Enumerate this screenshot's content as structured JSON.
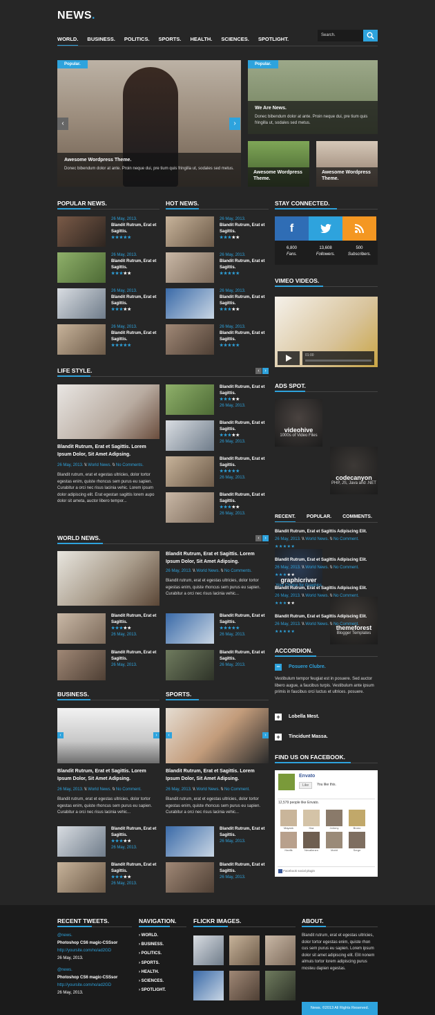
{
  "logo": {
    "text": "NEWS",
    "dot": "."
  },
  "nav": [
    "WORLD.",
    "BUSINESS.",
    "POLITICS.",
    "SPORTS.",
    "HEALTH.",
    "SCIENCES.",
    "SPOTLIGHT."
  ],
  "search": {
    "placeholder": "Search."
  },
  "slider": {
    "badge": "Popular.",
    "title": "Awesome Wordpress Theme.",
    "text": "Donec bibendum dolor at ante. Proin neque dui, pre tium quis fringilla ut,  sodales sed metus."
  },
  "popular_box": {
    "badge": "Popular.",
    "title": "We Are News.",
    "text": "Donec bibendum dolor at ante. Proin neque dui, pre tium quis fringilla ut,  sodales sed metus."
  },
  "small_tiles": [
    "Awesome Wordpress Theme.",
    "Awesome Wordpress Theme."
  ],
  "popular_news": {
    "title": "POPULAR NEWS.",
    "items": [
      {
        "date": "26 May, 2013.",
        "text": "Blandit Rutrum, Erat et Sagittis.",
        "stars": 5
      },
      {
        "date": "26 May, 2013.",
        "text": "Blandit Rutrum, Erat et Sagittis.",
        "stars": 3
      },
      {
        "date": "26 May, 2013.",
        "text": "Blandit Rutrum, Erat et Sagittis.",
        "stars": 3
      },
      {
        "date": "26 May, 2013.",
        "text": "Blandit Rutrum, Erat et Sagittis.",
        "stars": 5
      }
    ]
  },
  "hot_news": {
    "title": "HOT NEWS.",
    "items": [
      {
        "date": "26 May, 2013.",
        "text": "Blandit Rutrum, Erat et Sagittis.",
        "stars": 3
      },
      {
        "date": "26 May, 2013.",
        "text": "Blandit Rutrum, Erat et Sagittis.",
        "stars": 5
      },
      {
        "date": "26 May, 2013.",
        "text": "Blandit Rutrum, Erat et Sagittis.",
        "stars": 3
      },
      {
        "date": "26 May, 2013.",
        "text": "Blandit Rutrum, Erat et Sagittis.",
        "stars": 5
      }
    ]
  },
  "stay_connected": {
    "title": "STAY CONNECTED.",
    "stats": [
      {
        "num": "6,800",
        "label": "Fans."
      },
      {
        "num": "13,608",
        "label": "Followers."
      },
      {
        "num": "500",
        "label": "Subscribers."
      }
    ]
  },
  "vimeo": {
    "title": "VIMEO VIDEOS.",
    "time": "01:00"
  },
  "lifestyle": {
    "title": "LIFE STYLE.",
    "headline": "Blandit Rutrum, Erat et Sagittis. Lorem Ipsum Dolor, Sit Amet Adipsing.",
    "date": "26 May, 2013.",
    "sep": "\\\\",
    "cat": "World News.",
    "comments": "No Comments.",
    "body": "Blandit rutrum, erat et egestas ultricies, dolor tortor egestas enim, quiste rhoncus sem purus eu sapien. Curabitur a orci nec risus lacinia vehic. Lorem ipsum dolor adipiscing elit. Erat egestan sagittis lorem aupo dolor sit ameta, auctor libero tempor...",
    "items": [
      {
        "text": "Blandit Rutrum, Erat et Sagittis.",
        "date": "26 May, 2013.",
        "stars": 3
      },
      {
        "text": "Blandit Rutrum, Erat et Sagittis.",
        "date": "26 May, 2013.",
        "stars": 3
      },
      {
        "text": "Blandit Rutrum, Erat et Sagittis.",
        "date": "26 May, 2013.",
        "stars": 5
      },
      {
        "text": "Blandit Rutrum, Erat et Sagittis.",
        "date": "26 May, 2013.",
        "stars": 3
      }
    ]
  },
  "ads": {
    "title": "ADS SPOT.",
    "items": [
      {
        "name": "videohive",
        "sub": "1000s of Video Files"
      },
      {
        "name": "codecanyon",
        "sub": "PHP, JS, Java and .NET"
      },
      {
        "name": "graphicriver",
        "sub": "Your Choice for Graphics"
      },
      {
        "name": "themeforest",
        "sub": "Blogger Templates"
      }
    ]
  },
  "tabs": {
    "labels": [
      "RECENT.",
      "POPULAR.",
      "COMMENTS."
    ],
    "items": [
      {
        "text": "Blandit Rutrum, Erat et Sagittis Adipiscing Elit.",
        "date": "26 May, 2013.",
        "cat": "World News.",
        "comments": "No Comment.",
        "stars": 5
      },
      {
        "text": "Blandit Rutrum, Erat et Sagittis Adipiscing Elit.",
        "date": "26 May, 2013.",
        "cat": "World News.",
        "comments": "No Comment.",
        "stars": 3
      },
      {
        "text": "Blandit Rutrum, Erat et Sagittis Adipiscing Elit.",
        "date": "26 May, 2013.",
        "cat": "World News.",
        "comments": "No Comment.",
        "stars": 3
      },
      {
        "text": "Blandit Rutrum, Erat et Sagittis Adipiscing Elit.",
        "date": "26 May, 2013.",
        "cat": "World News.",
        "comments": "No Comment.",
        "stars": 5
      }
    ]
  },
  "world_news": {
    "title": "WORLD NEWS.",
    "headline": "Blandit Rutrum, Erat et Sagittis. Lorem Ipsum Dolor, Sit Amet Adipsing.",
    "date": "26 May, 2013.",
    "cat": "World News.",
    "comments": "No Comments.",
    "body": "Blandit rutrum, erat et egestas ultricies, dolor tortor egestas enim, quiste rhoncus sem purus eu sapien. Curabitur a orci nec risus lacinia vehic...",
    "items": [
      {
        "text": "Blandit Rutrum, Erat et Sagittis.",
        "date": "26 May, 2013.",
        "stars": 3
      },
      {
        "text": "Blandit Rutrum, Erat et Sagittis.",
        "date": "26 May, 2013.",
        "stars": 5
      },
      {
        "text": "Blandit Rutrum, Erat et Sagittis.",
        "date": "26 May, 2013.",
        "stars": 0
      },
      {
        "text": "Blandit Rutrum, Erat et Sagittis.",
        "date": "26 May, 2013.",
        "stars": 0
      }
    ]
  },
  "accordion": {
    "title": "ACCORDION.",
    "open": "Posuere Clubre.",
    "body": "Vestibulum tempor feugiat est in posuere. Sed auctor libero augue, a faucibus turpis. Vestibulum ante ipsum primis in faucibus orci luctus et ultrices. posuere.",
    "closed": [
      "Lobella Mest.",
      "Tincidunt Massa."
    ]
  },
  "business": {
    "title": "BUSINESS.",
    "headline": "Blandit Rutrum, Erat et Sagittis. Lorem Ipsum Dolor, Sit Amet Adipsing.",
    "date": "26 May, 2013.",
    "cat": "World News.",
    "comments": "No Comment.",
    "body": "Blandit rutrum, erat et egestas ultricies, dolor tortor egestas enim, quiste rhoncus sem purus eu sapien. Curabitur a orci nec risus lacinia vehic...",
    "items": [
      {
        "text": "Blandit Rutrum, Erat et Sagittis.",
        "date": "26 May, 2013.",
        "stars": 3
      },
      {
        "text": "Blandit Rutrum, Erat et Sagittis.",
        "date": "26 May, 2013.",
        "stars": 3
      }
    ]
  },
  "sports": {
    "title": "SPORTS.",
    "headline": "Blandit Rutrum, Erat et Sagittis. Lorem Ipsum Dolor, Sit Amet Adipsing.",
    "date": "26 May, 2013.",
    "cat": "World News.",
    "comments": "No Comment.",
    "body": "Blandit rutrum, erat et egestas ultricies, dolor tortor egestas enim, quiste rhoncus sem purus eu sapien. Curabitur a orci nec risus lacinia vehic...",
    "items": [
      {
        "text": "Blandit Rutrum, Erat et Sagittis.",
        "date": "26 May, 2013.",
        "stars": 0
      },
      {
        "text": "Blandit Rutrum, Erat et Sagittis.",
        "date": "26 May, 2013.",
        "stars": 0
      }
    ]
  },
  "facebook": {
    "title": "FIND US ON FACEBOOK.",
    "page": "Envato",
    "like": "Like",
    "like_text": "You like this.",
    "count": "12,579 people like Envato.",
    "people": [
      "Mayank",
      "Haz",
      "Johnny",
      "Bruno",
      "Hanfik",
      "Nevallenen",
      "Mohit",
      "Serge"
    ],
    "plugin": "Facebook social plugin"
  },
  "footer": {
    "tweets": {
      "title": "RECENT TWEETS.",
      "items": [
        {
          "user": "@news.",
          "text": "Photoshop CS6 magic-CSSsor",
          "link": "http://yoursite.com/no/ad2GD",
          "date": "26 May, 2013."
        },
        {
          "user": "@news.",
          "text": "Photoshop CS6 magic-CSSsor",
          "link": "http://yoursite.com/no/ad2GD",
          "date": "26 May, 2013."
        }
      ]
    },
    "navigation": {
      "title": "NAVIGATION.",
      "items": [
        "WORLD.",
        "BUSINESS.",
        "POLITICS.",
        "SPORTS.",
        "HEALTH.",
        "SCIENCES.",
        "SPOTLIGHT."
      ]
    },
    "flickr": {
      "title": "FLICKR IMAGES."
    },
    "about": {
      "title": "ABOUT.",
      "text": "Blandit rutrum, erat et egestas ultricies, dolor tortor egestas enim, quiste rhon cus sem purus eu sapien. Lorem ipsum dolor sit amet adipiscing elit. Elit nonem almuis tortor lorem adipiscing purus mosteu dapien egestas."
    },
    "copyright": "News. ©2013 All Rights Reserved."
  }
}
